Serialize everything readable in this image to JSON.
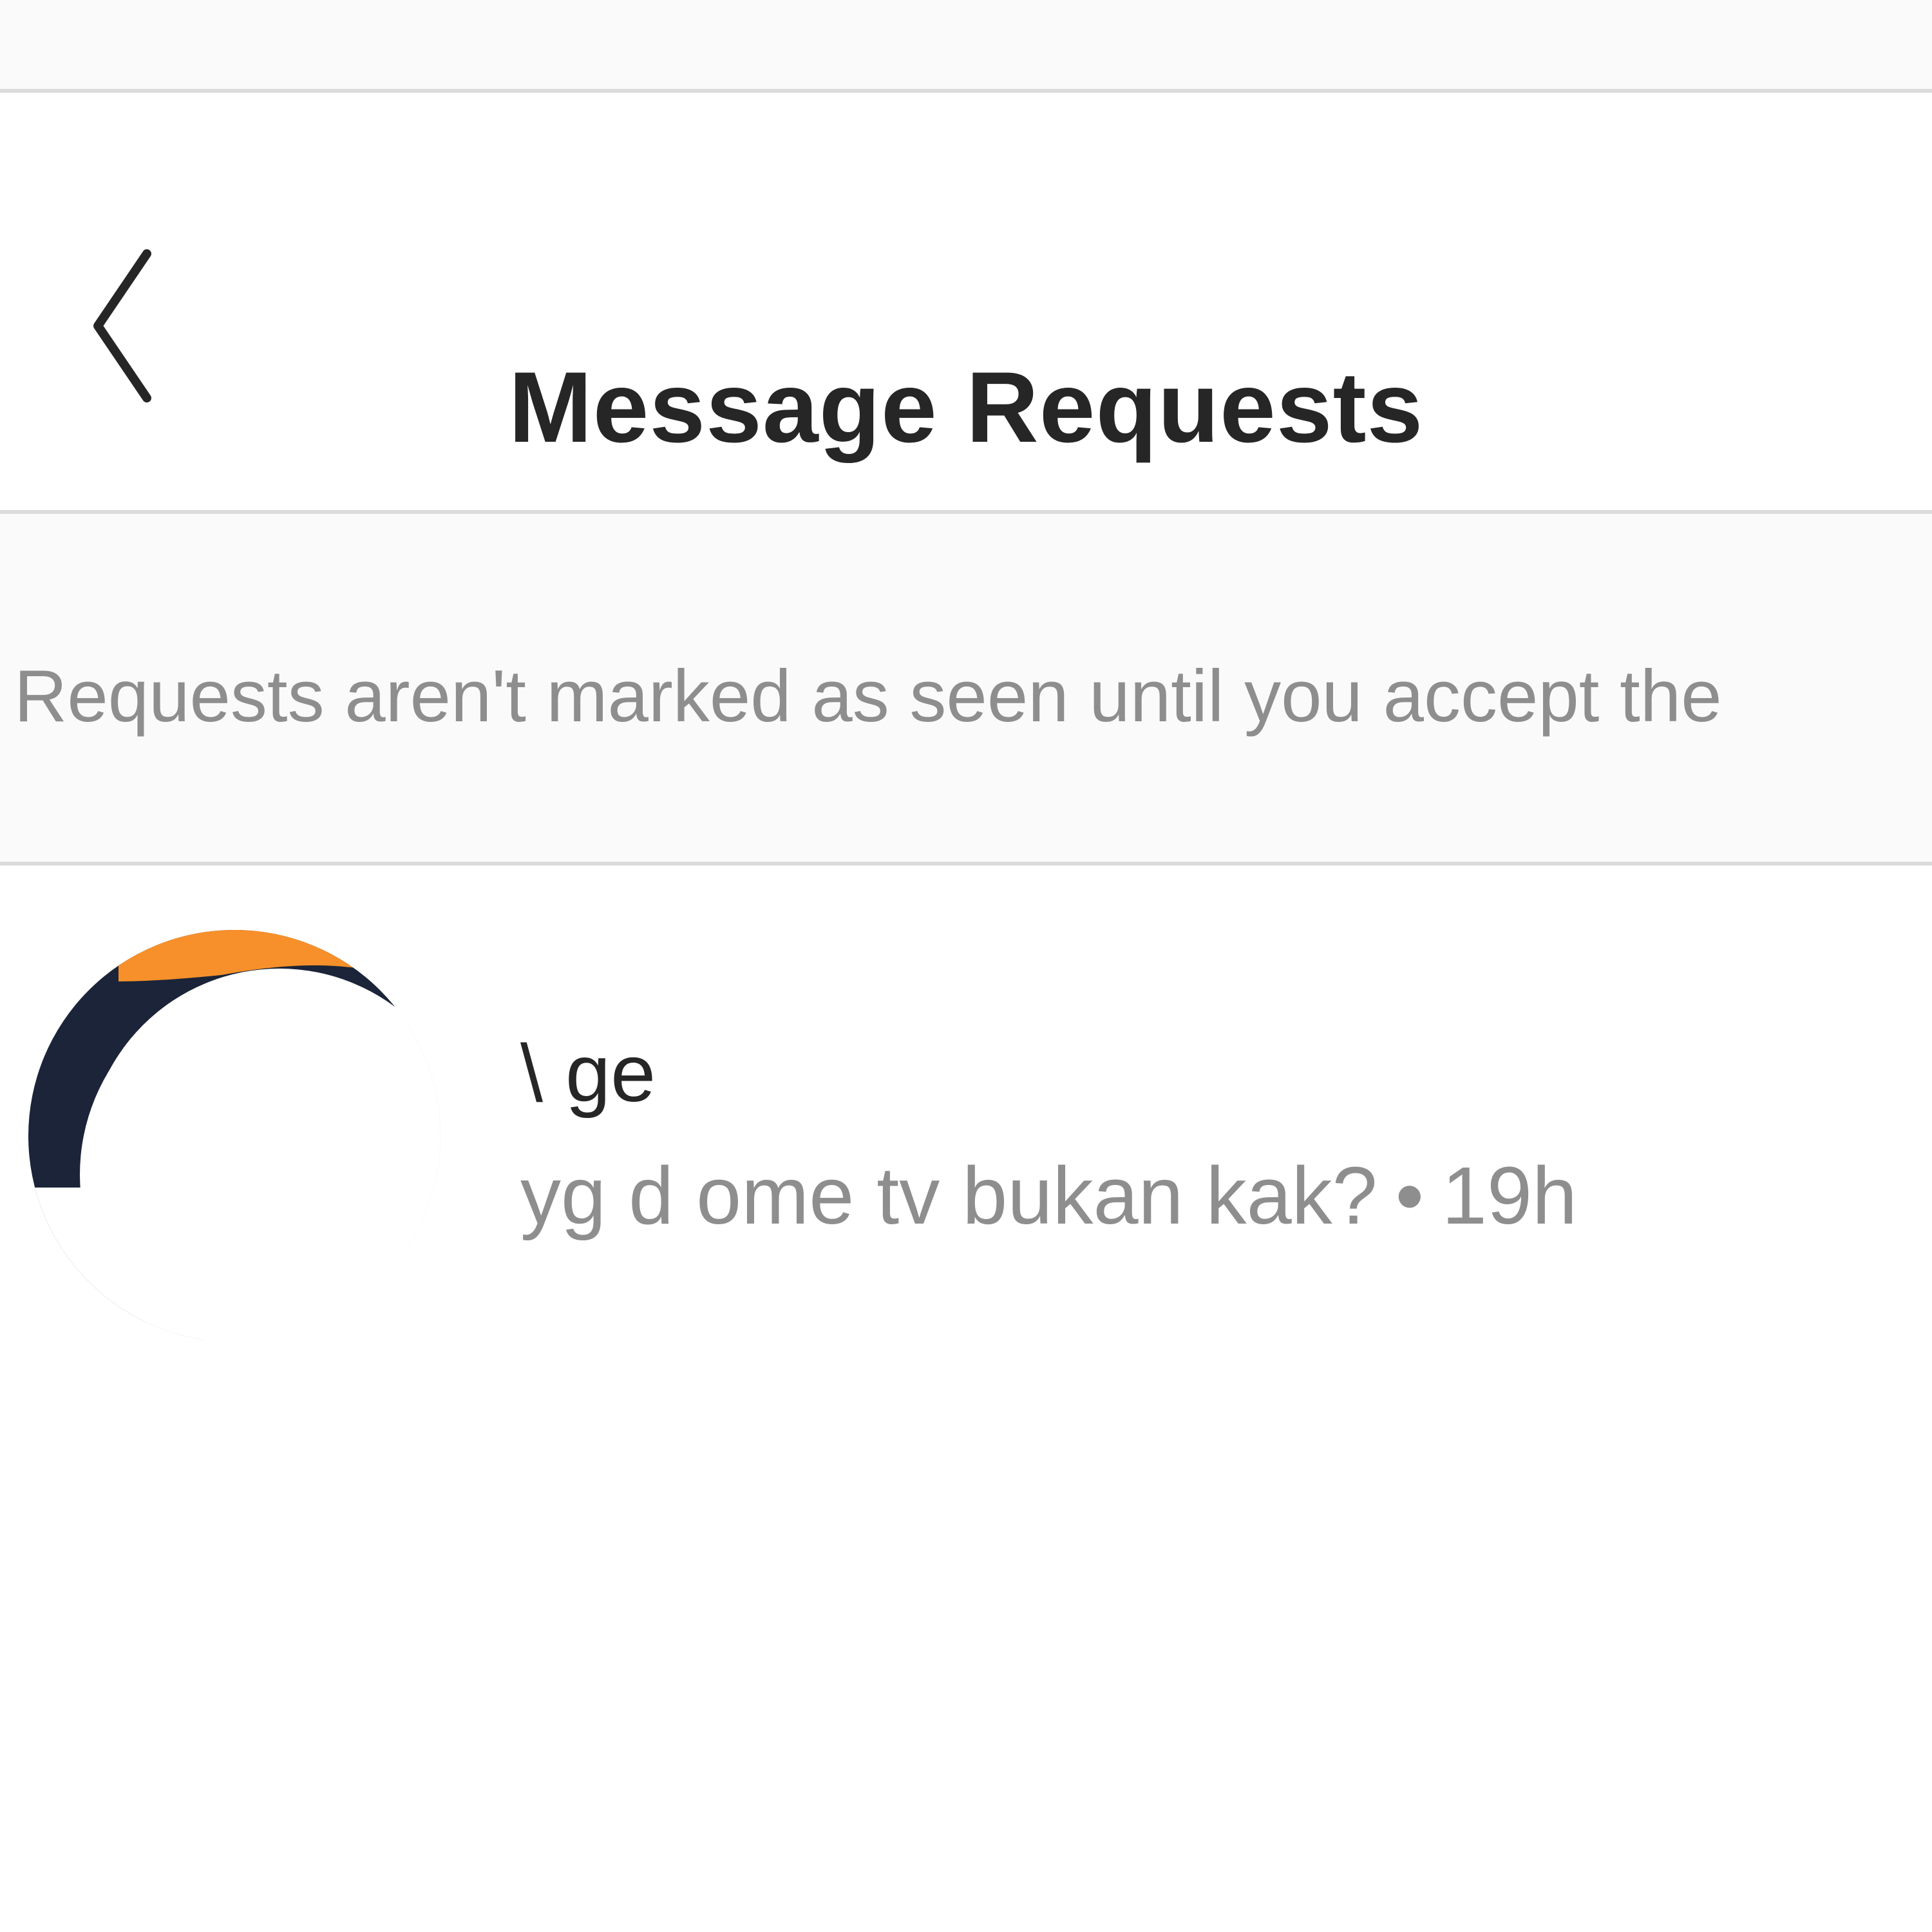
{
  "header": {
    "title": "Message Requests",
    "back_icon": "chevron-left-icon"
  },
  "notice": {
    "text": "Requests aren't marked as seen until you accept the"
  },
  "requests": [
    {
      "username": "\\ ge",
      "message": "yg d ome tv bukan kak?",
      "separator": "•",
      "time": "19h",
      "avatar_colors": [
        "#f7902a",
        "#1b2438",
        "#c4a3d9"
      ]
    }
  ],
  "colors": {
    "divider": "#dbdbdb",
    "muted_bg": "#fafafa",
    "text_primary": "#262626",
    "text_secondary": "#8e8e8e"
  }
}
